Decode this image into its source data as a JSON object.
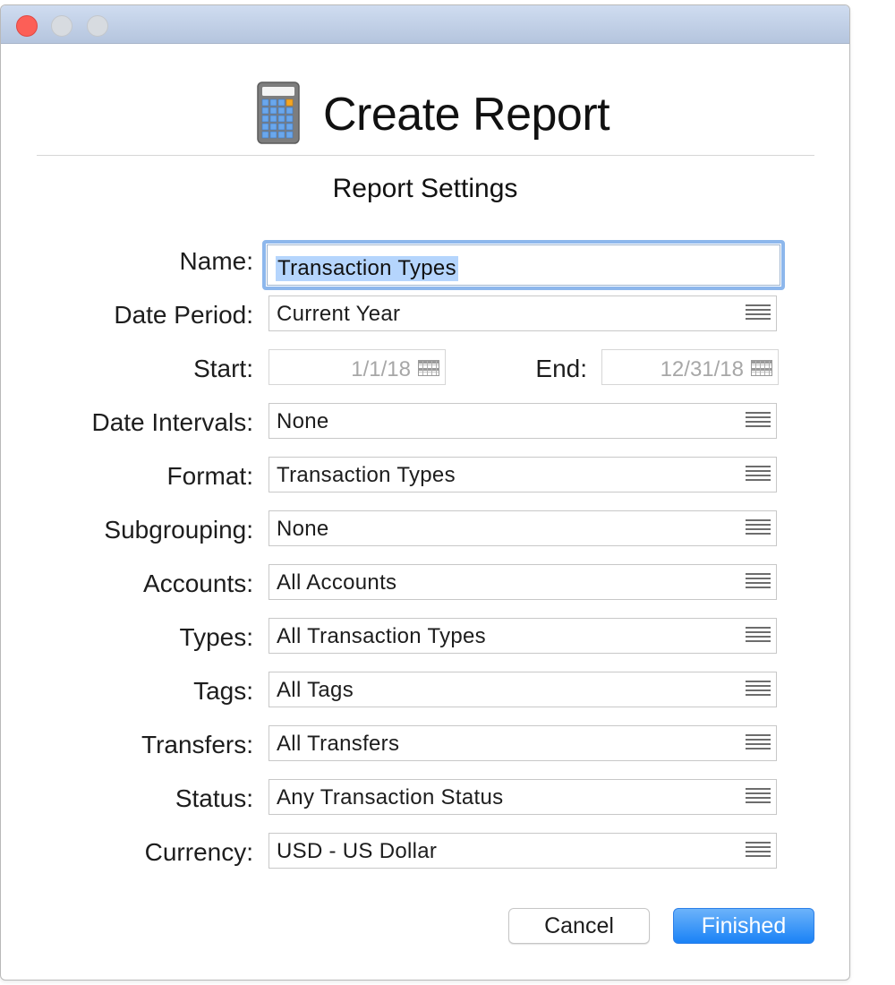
{
  "window": {
    "title": "Create Report",
    "icon": "calculator-icon"
  },
  "section_title": "Report Settings",
  "form": {
    "name": {
      "label": "Name:",
      "value": "Transaction Types"
    },
    "date_period": {
      "label": "Date Period:",
      "value": "Current Year"
    },
    "start": {
      "label": "Start:",
      "value": "1/1/18"
    },
    "end": {
      "label": "End:",
      "value": "12/31/18"
    },
    "date_intervals": {
      "label": "Date Intervals:",
      "value": "None"
    },
    "format": {
      "label": "Format:",
      "value": "Transaction Types"
    },
    "subgrouping": {
      "label": "Subgrouping:",
      "value": "None"
    },
    "accounts": {
      "label": "Accounts:",
      "value": "All Accounts"
    },
    "types": {
      "label": "Types:",
      "value": "All Transaction Types"
    },
    "tags": {
      "label": "Tags:",
      "value": "All Tags"
    },
    "transfers": {
      "label": "Transfers:",
      "value": "All Transfers"
    },
    "status": {
      "label": "Status:",
      "value": "Any Transaction Status"
    },
    "currency": {
      "label": "Currency:",
      "value": "USD - US Dollar"
    }
  },
  "buttons": {
    "cancel": "Cancel",
    "finished": "Finished"
  },
  "colors": {
    "accent": "#1a82f6",
    "selection": "#b5d5fd",
    "close": "#fc5f57"
  }
}
